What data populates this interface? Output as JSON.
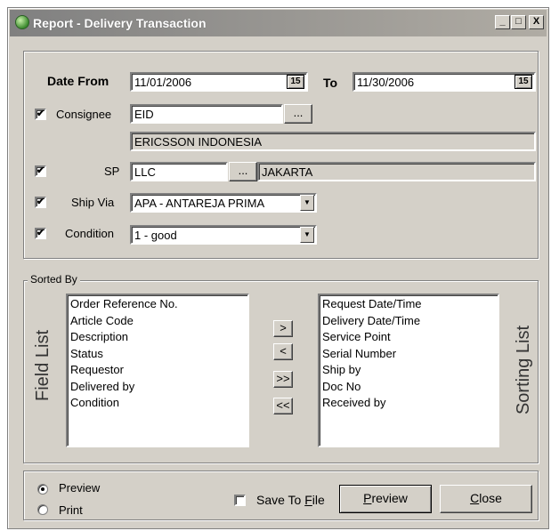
{
  "window": {
    "title": "Report - Delivery Transaction"
  },
  "titlebar_buttons": {
    "minimize": "_",
    "maximize": "□",
    "close": "X"
  },
  "filters": {
    "date_from_label": "Date From",
    "date_from_value": "11/01/2006",
    "to_label": "To",
    "date_to_value": "11/30/2006",
    "calendar_glyph": "15",
    "consignee_label": "Consignee",
    "consignee_checked": true,
    "consignee_value": "EID",
    "consignee_name": "ERICSSON INDONESIA",
    "sp_label": "SP",
    "sp_checked": true,
    "sp_value": "LLC",
    "sp_name": "JAKARTA",
    "ship_via_label": "Ship Via",
    "ship_via_checked": true,
    "ship_via_value": "APA - ANTAREJA PRIMA",
    "condition_label": "Condition",
    "condition_checked": true,
    "condition_value": "1 - good",
    "browse_label": "..."
  },
  "sorted_by": {
    "group_label": "Sorted By",
    "field_list_label": "Field List",
    "sorting_list_label": "Sorting List",
    "field_list": [
      "Order Reference No.",
      "Article Code",
      "Description",
      "Status",
      "Requestor",
      "Delivered by",
      "Condition"
    ],
    "sorting_list": [
      "Request Date/Time",
      "Delivery Date/Time",
      "Service Point",
      "Serial Number",
      "Ship by",
      "Doc No",
      "Received by"
    ],
    "move_buttons": [
      ">",
      "<",
      ">>",
      "<<"
    ]
  },
  "output": {
    "preview_radio_label": "Preview",
    "print_radio_label": "Print",
    "selected": "Preview",
    "save_to_file_label_pre": "Save To ",
    "save_to_file_label_ul": "F",
    "save_to_file_label_post": "ile",
    "save_to_file_checked": false,
    "preview_button_ul": "P",
    "preview_button_rest": "review",
    "close_button_ul": "C",
    "close_button_rest": "lose"
  }
}
